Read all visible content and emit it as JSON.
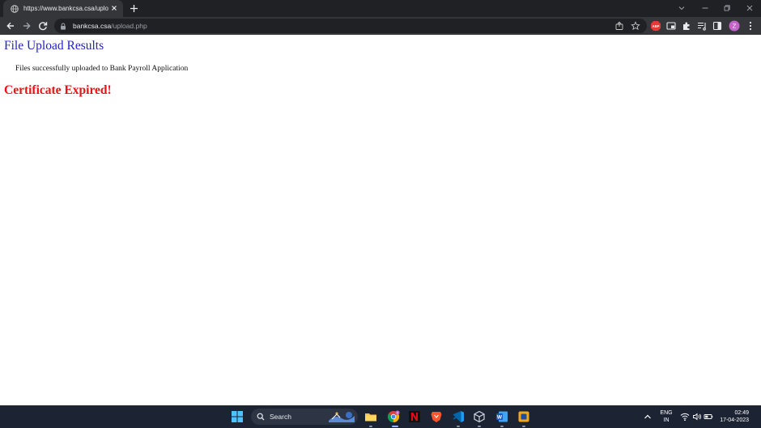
{
  "browser": {
    "tab_title": "https://www.bankcsa.csa/upload.",
    "url_host": "bankcsa.csa",
    "url_path": "/upload.php",
    "profile_initial": "Z",
    "adblock_label": "ABP"
  },
  "page": {
    "title": "File Upload Results",
    "message": "Files successfully uploaded to Bank Payroll Application",
    "alert": "Certificate Expired!",
    "title_color": "#1f1fcf",
    "alert_color": "#ee1111"
  },
  "taskbar": {
    "search_label": "Search",
    "chrome_badge": "2",
    "language": "ENG",
    "region": "IN",
    "time": "02:49",
    "date": "17-04-2023"
  }
}
